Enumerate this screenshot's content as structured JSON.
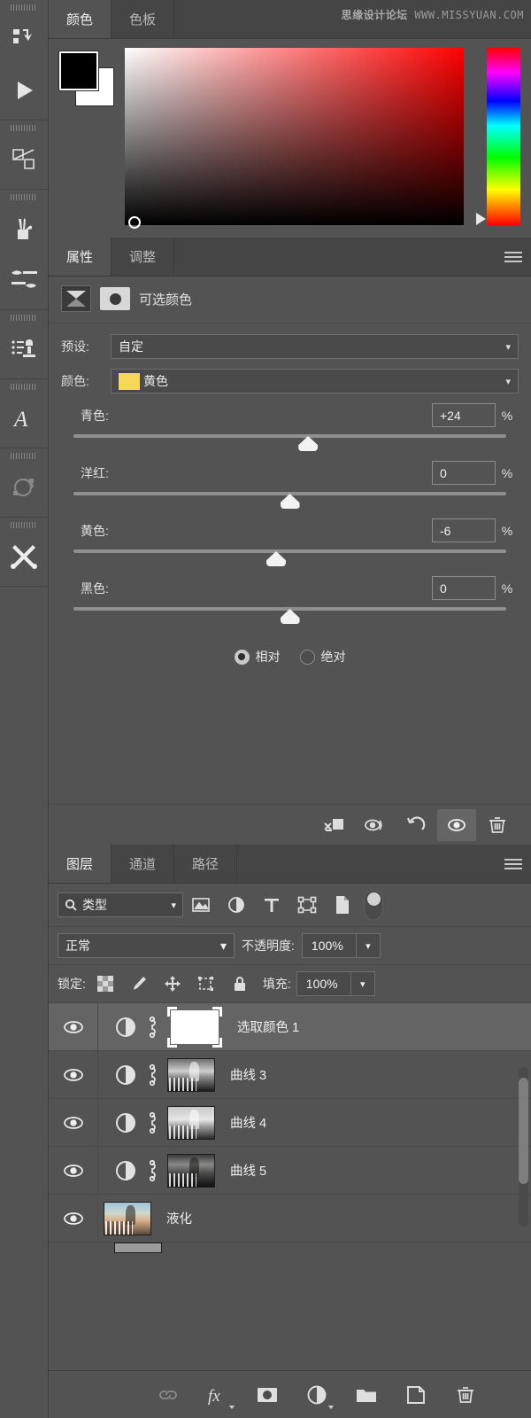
{
  "watermark": {
    "cn": "思缘设计论坛",
    "url": "WWW.MISSYUAN.COM"
  },
  "toolrail": {
    "items": [
      {
        "name": "history-panel-icon",
        "label": "历史记录"
      },
      {
        "name": "actions-play-icon",
        "label": "动作"
      },
      {
        "name": "styles-panel-icon",
        "label": "样式"
      },
      {
        "name": "brushes-panel-icon",
        "label": "画笔"
      },
      {
        "name": "brush-settings-icon",
        "label": "画笔设置"
      },
      {
        "name": "clone-source-icon",
        "label": "仿制源"
      },
      {
        "name": "character-panel-icon",
        "label": "字符"
      },
      {
        "name": "paths-panel-icon",
        "label": "路径"
      },
      {
        "name": "tool-presets-icon",
        "label": "工具预设"
      }
    ]
  },
  "color_panel": {
    "tabs": [
      {
        "label": "颜色",
        "active": true
      },
      {
        "label": "色板",
        "active": false
      }
    ],
    "foreground_color": "#000000",
    "background_color": "#ffffff",
    "ramp_base_hue": "#ff0000"
  },
  "properties_panel": {
    "tabs": [
      {
        "label": "属性",
        "active": true
      },
      {
        "label": "调整",
        "active": false
      }
    ],
    "title": "可选颜色",
    "preset": {
      "label": "预设:",
      "value": "自定"
    },
    "color": {
      "label": "颜色:",
      "value": "黄色",
      "swatch": "#f5d857"
    },
    "sliders": [
      {
        "label": "青色:",
        "value": "+24",
        "unit": "%",
        "pos": 54
      },
      {
        "label": "洋红:",
        "value": "0",
        "unit": "%",
        "pos": 50
      },
      {
        "label": "黄色:",
        "value": "-6",
        "unit": "%",
        "pos": 47
      },
      {
        "label": "黑色:",
        "value": "0",
        "unit": "%",
        "pos": 50
      }
    ],
    "method": {
      "options": [
        {
          "label": "相对",
          "selected": true
        },
        {
          "label": "绝对",
          "selected": false
        }
      ]
    },
    "footer_buttons": [
      {
        "name": "clip-to-layer-button",
        "active": false
      },
      {
        "name": "toggle-previous-state-button",
        "active": false
      },
      {
        "name": "reset-button",
        "active": false
      },
      {
        "name": "toggle-visibility-button",
        "active": true
      },
      {
        "name": "delete-adjustment-button",
        "active": false
      }
    ]
  },
  "layers_panel": {
    "tabs": [
      {
        "label": "图层",
        "active": true
      },
      {
        "label": "通道",
        "active": false
      },
      {
        "label": "路径",
        "active": false
      }
    ],
    "filter": {
      "kind_label": "类型",
      "icons": [
        "pixel-filter-icon",
        "adjustment-filter-icon",
        "type-filter-icon",
        "shape-filter-icon",
        "smartobject-filter-icon"
      ],
      "toggle_on": false
    },
    "blend": {
      "mode": "正常",
      "opacity_label": "不透明度:",
      "opacity_value": "100%"
    },
    "lock": {
      "label": "锁定:",
      "icons": [
        "lock-transparency-icon",
        "lock-image-icon",
        "lock-position-icon",
        "lock-artboard-icon",
        "lock-all-icon"
      ],
      "fill_label": "填充:",
      "fill_value": "100%"
    },
    "layers": [
      {
        "name": "选取颜色 1",
        "type": "adjustment-mask",
        "selected": true,
        "visible": true,
        "thumb": "white"
      },
      {
        "name": "曲线 3",
        "type": "adjustment",
        "selected": false,
        "visible": true,
        "thumb": "bw1"
      },
      {
        "name": "曲线 4",
        "type": "adjustment",
        "selected": false,
        "visible": true,
        "thumb": "bw2"
      },
      {
        "name": "曲线 5",
        "type": "adjustment",
        "selected": false,
        "visible": true,
        "thumb": "bw3"
      },
      {
        "name": "液化",
        "type": "pixel",
        "selected": false,
        "visible": true,
        "thumb": "color"
      }
    ],
    "footer_buttons": [
      {
        "name": "link-layers-button",
        "disabled": true
      },
      {
        "name": "layer-styles-fx-button",
        "disabled": false
      },
      {
        "name": "add-layer-mask-button",
        "disabled": false
      },
      {
        "name": "new-adjustment-layer-button",
        "disabled": false
      },
      {
        "name": "new-group-button",
        "disabled": false
      },
      {
        "name": "new-layer-button",
        "disabled": false
      },
      {
        "name": "delete-layer-button",
        "disabled": false
      }
    ]
  }
}
